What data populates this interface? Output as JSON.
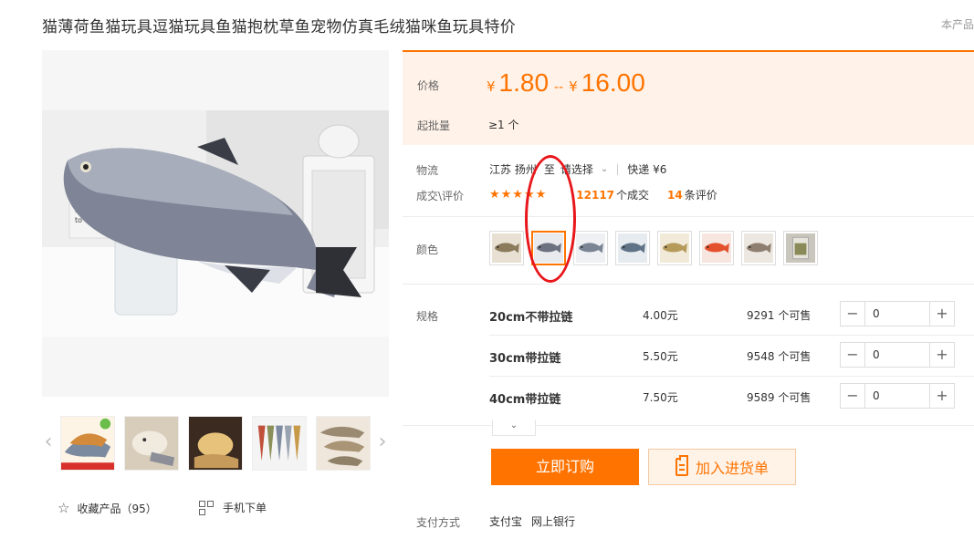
{
  "product": {
    "title": "猫薄荷鱼猫玩具逗猫玩具鱼猫抱枕草鱼宠物仿真毛绒猫咪鱼玩具特价",
    "top_right_text": "本产品"
  },
  "price": {
    "label": "价格",
    "currency": "¥",
    "min": "1.80",
    "separator": "--",
    "max": "16.00",
    "moq_label": "起批量",
    "moq_value": "≥1 个"
  },
  "logistics": {
    "label": "物流",
    "origin": "江苏 扬州",
    "to": "至",
    "destination_placeholder": "请选择",
    "express": "快递 ¥6"
  },
  "deals": {
    "label": "成交\\评价",
    "stars": "★★★★★",
    "deal_count": "12117",
    "deal_suffix": "个成交",
    "review_count": "14",
    "review_suffix": "条评价"
  },
  "color": {
    "label": "颜色",
    "selected_index": 1,
    "swatches": [
      {
        "name": "fish-swatch-1",
        "fish": "#8c7a5c",
        "bg": "#e8e0d2"
      },
      {
        "name": "fish-swatch-2",
        "fish": "#6d7280",
        "bg": "#e9eaee"
      },
      {
        "name": "fish-swatch-3",
        "fish": "#7a8494",
        "bg": "#eef0f3"
      },
      {
        "name": "fish-swatch-4",
        "fish": "#5f7286",
        "bg": "#e6ebf0"
      },
      {
        "name": "fish-swatch-5",
        "fish": "#b59a5a",
        "bg": "#f1ead8"
      },
      {
        "name": "fish-swatch-6",
        "fish": "#e4502c",
        "bg": "#f7e6df"
      },
      {
        "name": "fish-swatch-7",
        "fish": "#8e7f70",
        "bg": "#ece7e1"
      },
      {
        "name": "catnip-swatch",
        "fish": "#8a8a58",
        "bg": "#c9c7bd"
      }
    ]
  },
  "specs": {
    "label": "规格",
    "rows": [
      {
        "name": "20cm不带拉链",
        "price": "4.00元",
        "stock": "9291 个可售",
        "qty": "0"
      },
      {
        "name": "30cm带拉链",
        "price": "5.50元",
        "stock": "9548 个可售",
        "qty": "0"
      },
      {
        "name": "40cm带拉链",
        "price": "7.50元",
        "stock": "9589 个可售",
        "qty": "0"
      }
    ],
    "minus": "−",
    "plus": "+"
  },
  "actions": {
    "buy_now": "立即订购",
    "add_to_list": "加入进货单",
    "favorite": "收藏产品（95）",
    "mobile_order": "手机下单",
    "expand": "⌄"
  },
  "payment": {
    "label": "支付方式",
    "methods": [
      "支付宝",
      "网上银行"
    ]
  },
  "gallery": {
    "prev": "‹",
    "next": "›"
  },
  "colors": {
    "accent": "#ff7300",
    "price_bg": "#fff2e8",
    "annotation": "#e8161b"
  }
}
